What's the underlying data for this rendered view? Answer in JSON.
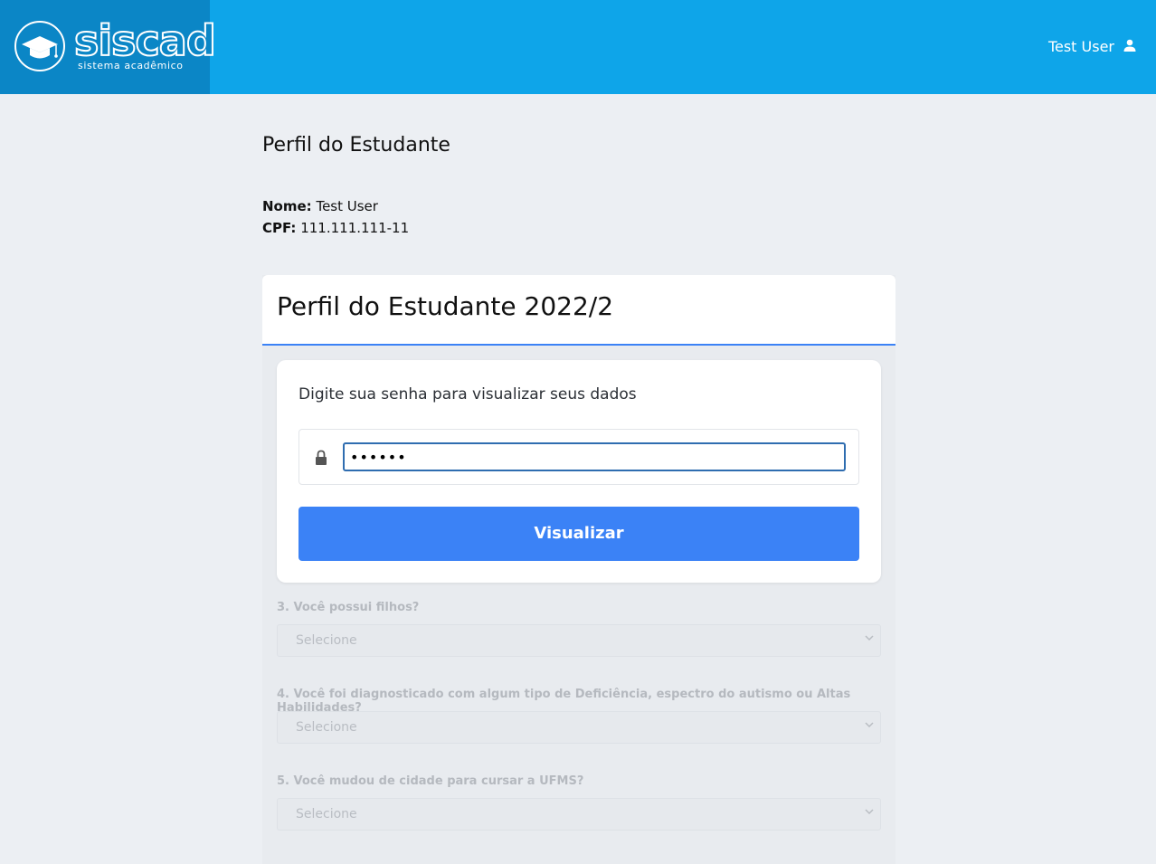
{
  "header": {
    "logo_text": "siscad",
    "logo_subtitle": "sistema acadêmico",
    "user_name": "Test User",
    "bg_color": "#0ea5e9",
    "logo_bg_color": "#0b86c6"
  },
  "page": {
    "title": "Perfil do Estudante",
    "nome_label": "Nome:",
    "nome_value": "Test User",
    "cpf_label": "CPF:",
    "cpf_value": "111.111.111-11"
  },
  "panel": {
    "title": "Perfil do Estudante 2022/2",
    "accent_color": "#3b82f6"
  },
  "modal": {
    "prompt": "Digite sua senha para visualizar seus dados",
    "password_value": "••••••",
    "button_label": "Visualizar"
  },
  "questions": [
    {
      "label": "3. Você possui filhos?",
      "placeholder": "Selecione"
    },
    {
      "label": "4. Você foi diagnosticado com algum tipo de Deficiência, espectro do autismo ou Altas Habilidades?",
      "placeholder": "Selecione"
    },
    {
      "label": "5. Você mudou de cidade para cursar a UFMS?",
      "placeholder": "Selecione"
    }
  ],
  "icons": {
    "logo": "graduation-cap-icon",
    "user": "person-icon",
    "lock": "lock-icon",
    "select_arrow": "chevron-down-icon"
  }
}
